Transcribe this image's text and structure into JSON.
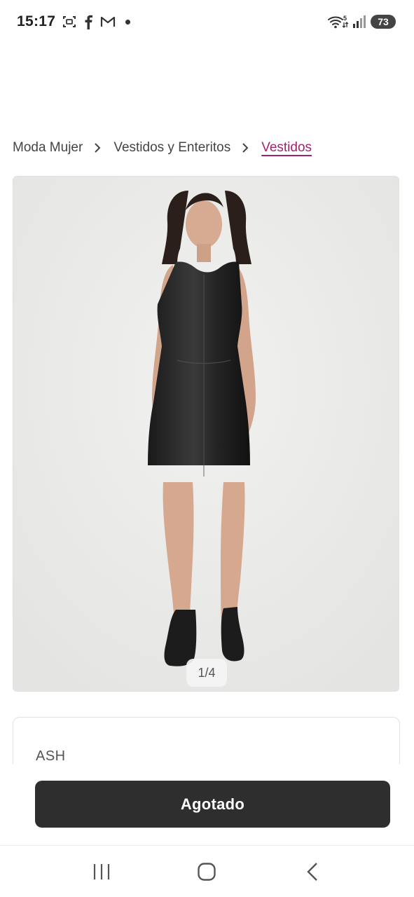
{
  "status_bar": {
    "time": "15:17",
    "battery": "73",
    "network": "5",
    "icons": [
      "screenshot-icon",
      "facebook-icon",
      "gmail-icon",
      "notification-dot",
      "wifi-icon",
      "signal-icon",
      "battery-icon"
    ]
  },
  "breadcrumb": {
    "items": [
      "Moda Mujer",
      "Vestidos y Enteritos"
    ],
    "active": "Vestidos",
    "active_color": "#a3226e"
  },
  "gallery": {
    "counter": "1/4"
  },
  "product": {
    "brand": "ASH"
  },
  "cta": {
    "label": "Agotado",
    "color": "#2e2e2e"
  },
  "nav": {
    "icons": [
      "recent-apps-icon",
      "home-icon",
      "back-icon"
    ]
  }
}
